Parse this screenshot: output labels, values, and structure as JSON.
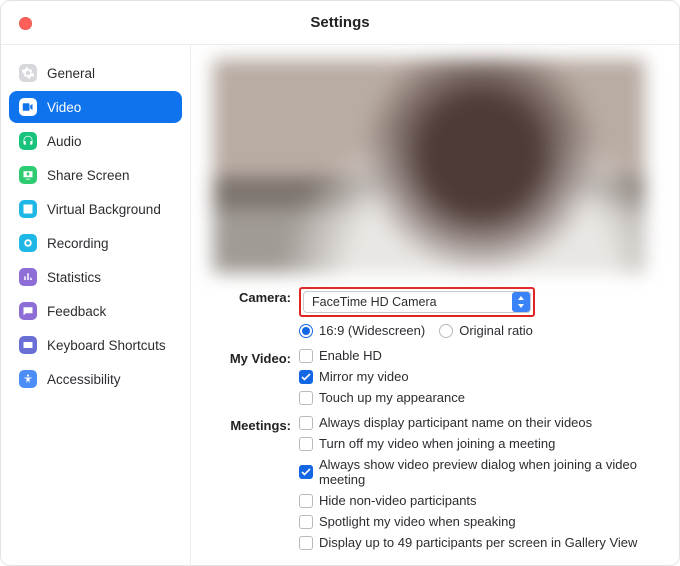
{
  "title": "Settings",
  "sidebar": {
    "items": [
      {
        "label": "General"
      },
      {
        "label": "Video"
      },
      {
        "label": "Audio"
      },
      {
        "label": "Share Screen"
      },
      {
        "label": "Virtual Background"
      },
      {
        "label": "Recording"
      },
      {
        "label": "Statistics"
      },
      {
        "label": "Feedback"
      },
      {
        "label": "Keyboard Shortcuts"
      },
      {
        "label": "Accessibility"
      }
    ],
    "active_index": 1
  },
  "section": {
    "camera_label": "Camera:",
    "camera_value": "FaceTime HD Camera",
    "ratio_169": "16:9 (Widescreen)",
    "ratio_orig": "Original ratio",
    "myvideo_label": "My Video:",
    "enable_hd": "Enable HD",
    "mirror": "Mirror my video",
    "touchup": "Touch up my appearance",
    "meetings_label": "Meetings:",
    "m1": "Always display participant name on their videos",
    "m2": "Turn off my video when joining a meeting",
    "m3": "Always show video preview dialog when joining a video meeting",
    "m4": "Hide non-video participants",
    "m5": "Spotlight my video when speaking",
    "m6": "Display up to 49 participants per screen in Gallery View"
  },
  "states": {
    "ratio_169": true,
    "ratio_orig": false,
    "enable_hd": false,
    "mirror": true,
    "touchup": false,
    "m1": false,
    "m2": false,
    "m3": true,
    "m4": false,
    "m5": false,
    "m6": false
  }
}
